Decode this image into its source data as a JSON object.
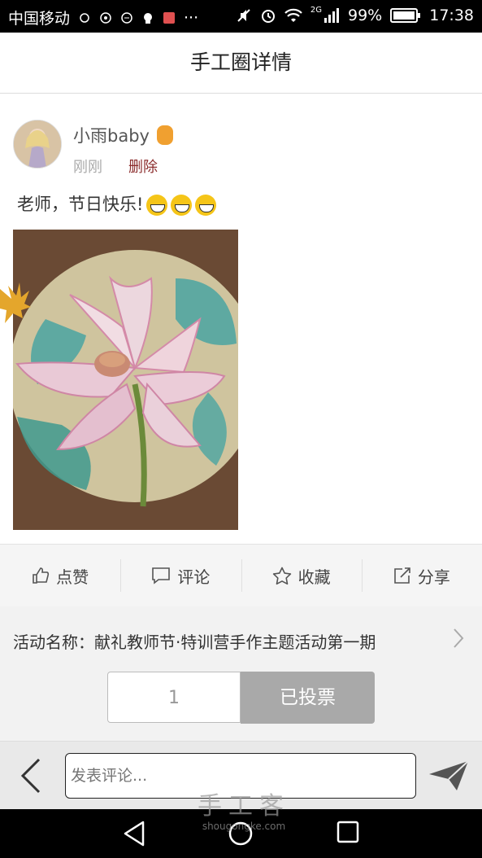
{
  "status_bar": {
    "carrier": "中国移动",
    "network": "2G",
    "battery": "99%",
    "time": "17:38"
  },
  "header": {
    "title": "手工圈详情"
  },
  "post": {
    "username": "小雨baby",
    "timestamp": "刚刚",
    "delete_label": "删除",
    "content": "老师，节日快乐!"
  },
  "actions": [
    {
      "label": "点赞",
      "icon": "thumbs-up-icon"
    },
    {
      "label": "评论",
      "icon": "comment-icon"
    },
    {
      "label": "收藏",
      "icon": "star-icon"
    },
    {
      "label": "分享",
      "icon": "share-icon"
    }
  ],
  "activity": {
    "label": "活动名称：献礼教师节·特训营手作主题活动第一期"
  },
  "vote": {
    "count": "1",
    "button_label": "已投票"
  },
  "comment_bar": {
    "placeholder": "发表评论..."
  },
  "watermark": {
    "line1": "手工客",
    "line2": "shougongke.com"
  }
}
